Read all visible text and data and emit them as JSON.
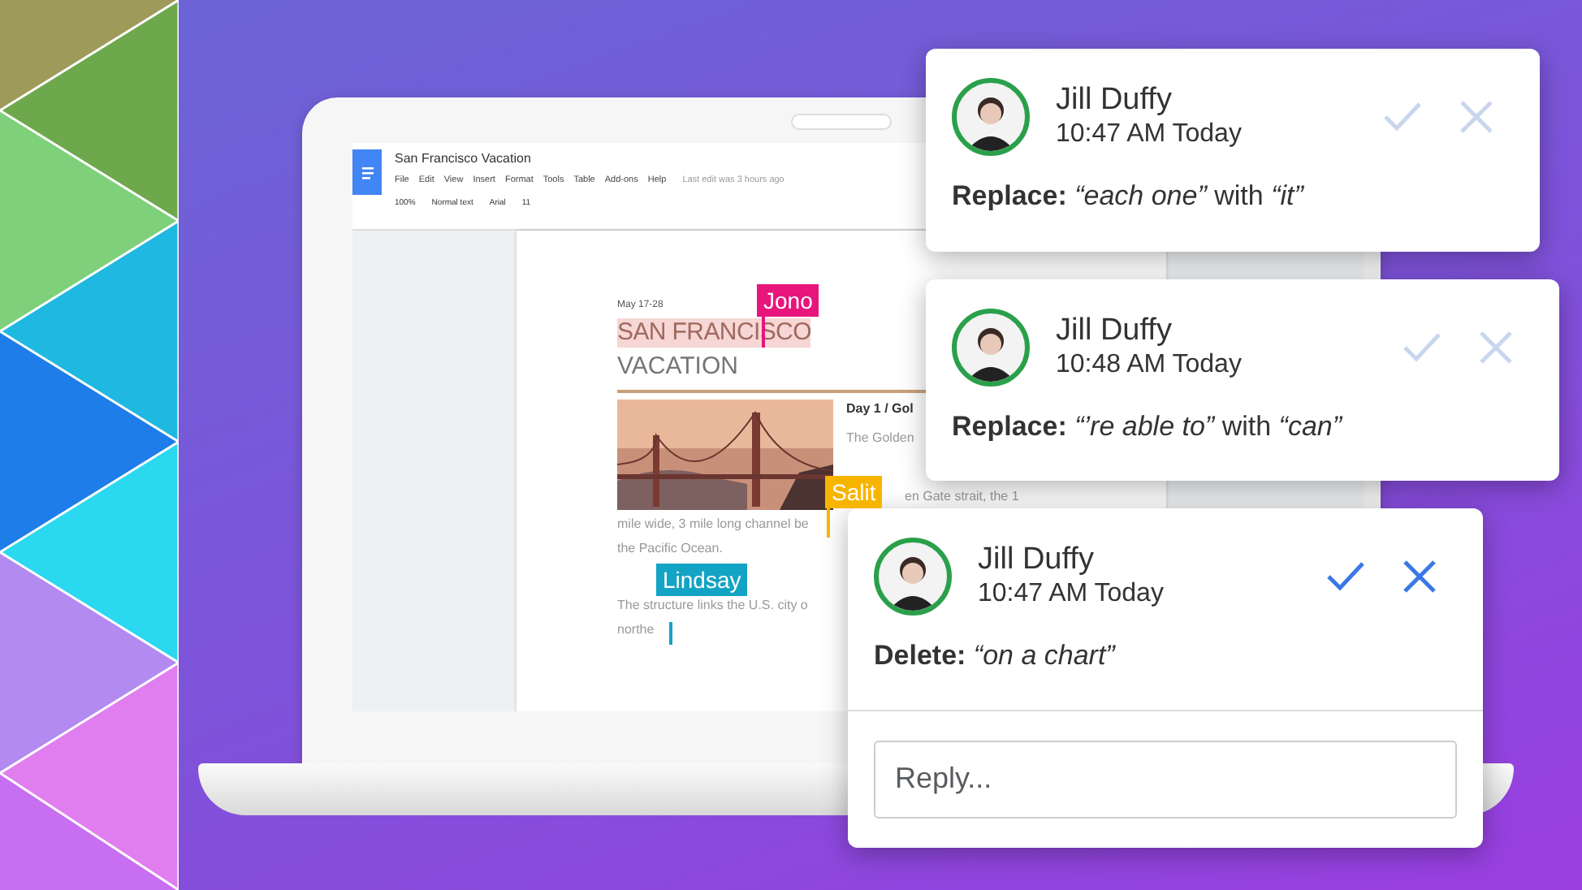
{
  "document": {
    "title": "San Francisco Vacation",
    "menu": [
      "File",
      "Edit",
      "View",
      "Insert",
      "Format",
      "Tools",
      "Table",
      "Add-ons",
      "Help"
    ],
    "last_edit": "Last edit was 3 hours ago",
    "toolbar": {
      "zoom": "100%",
      "style": "Normal text",
      "font": "Arial",
      "size": "11"
    },
    "page": {
      "date": "May 17-28",
      "heading_1": "SAN FRANCISCO",
      "heading_2": "VACATION",
      "day_heading": "Day 1 / Gol",
      "side_lines": [
        "The Golden",
        "en Gate strait, the 1"
      ],
      "body_lines": [
        "mile wide, 3 mile long channel be",
        "the Pacific Ocean."
      ],
      "body_lines_2": [
        "The structure links the U.S. city o",
        "northe"
      ]
    },
    "cursors": [
      {
        "name": "Jono",
        "color": "#e8157d"
      },
      {
        "name": "Salit",
        "color": "#f7b500"
      },
      {
        "name": "Lindsay",
        "color": "#13a3c4"
      }
    ]
  },
  "comments": [
    {
      "author": "Jill Duffy",
      "time": "10:47 AM Today",
      "text": "**Replace:** *“each one”* with *“it”*",
      "active": false
    },
    {
      "author": "Jill Duffy",
      "time": "10:48 AM Today",
      "text": "**Replace:** *“’re able to”* with *“can”*",
      "active": false
    },
    {
      "author": "Jill Duffy",
      "time": "10:47 AM Today",
      "text": "**Delete:** *“on a chart”*",
      "active": true,
      "reply": {
        "placeholder": "Reply..."
      }
    }
  ]
}
